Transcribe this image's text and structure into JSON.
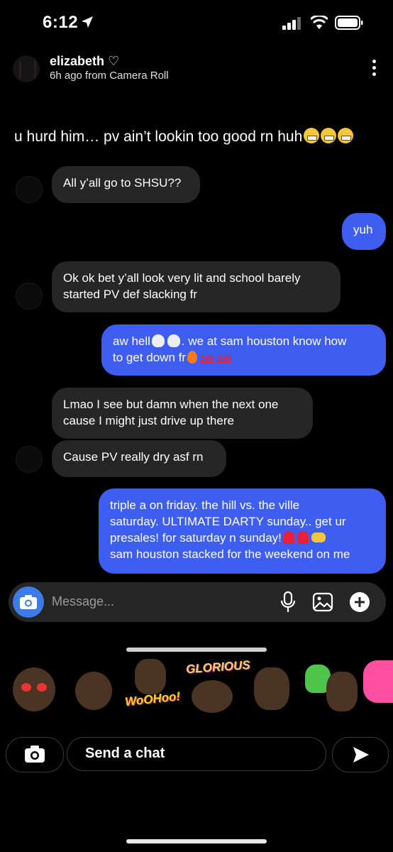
{
  "status_bar": {
    "time": "6:12"
  },
  "story": {
    "username": "elizabeth ♡",
    "subtitle": "6h ago from Camera Roll"
  },
  "caption": "u hurd him… pv ain’t lookin too good rn huh",
  "messages": [
    {
      "dir": "in",
      "text": "All y’all go to SHSU??"
    },
    {
      "dir": "out",
      "text": "yuh"
    },
    {
      "dir": "in",
      "line1": "Ok ok bet y’all look very lit and school barely",
      "line2": "started PV def slacking fr"
    },
    {
      "dir": "out",
      "line1a": "aw hell",
      "line1b": ". we at sam houston know how",
      "line2": "to get down fr",
      "hundred": "100"
    },
    {
      "dir": "in",
      "line1": "Lmao I see but damn when the next one",
      "line2": "cause I might just drive up there"
    },
    {
      "dir": "in",
      "text": "Cause PV really dry asf rn"
    },
    {
      "dir": "out",
      "line1": "triple a on friday. the hill vs. the ville",
      "line2": "saturday. ULTIMATE DARTY sunday.. get ur",
      "line3": "presales! for saturday n sunday!",
      "line4": "sam houston stacked for the weekend on me"
    }
  ],
  "input": {
    "placeholder": "Message..."
  },
  "stickers": {
    "woohoo": "WoOHoo!",
    "glorious": "GLORIOUS"
  },
  "bottom_bar": {
    "send_chat": "Send a chat"
  },
  "colors": {
    "outgoing_bubble": "#3d5ef0",
    "incoming_bubble": "#262626",
    "camera_button": "#3d7be8"
  }
}
